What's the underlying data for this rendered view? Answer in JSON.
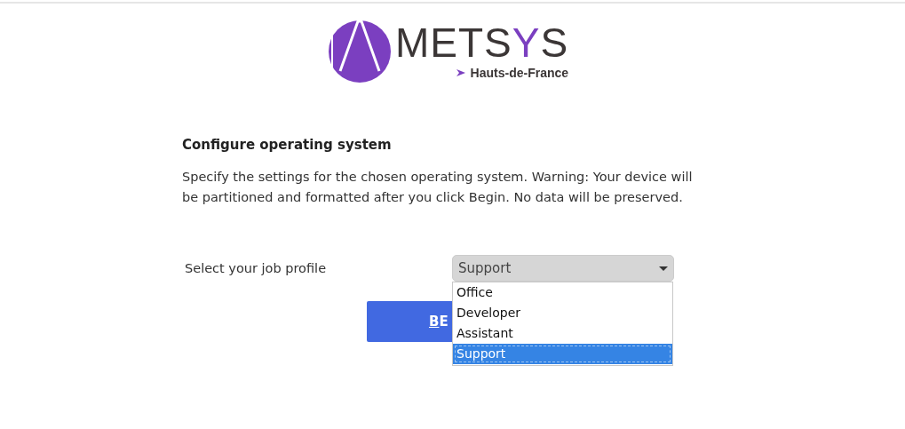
{
  "logo": {
    "wordmark": [
      {
        "text": "METS",
        "color": "#3b3636"
      },
      {
        "text": "Y",
        "color": "#7b3fc0"
      },
      {
        "text": "S",
        "color": "#3b3636"
      }
    ],
    "tagline": "Hauts-de-France"
  },
  "heading": "Configure operating system",
  "description": "Specify the settings for the chosen operating system. Warning: Your device will be partitioned and formatted after you click Begin. No data will be preserved.",
  "job_profile": {
    "label": "Select your job profile",
    "value": "Support",
    "expanded": true,
    "options": [
      {
        "label": "Office",
        "selected": false
      },
      {
        "label": "Developer",
        "selected": false
      },
      {
        "label": "Assistant",
        "selected": false
      },
      {
        "label": "Support",
        "selected": true
      }
    ]
  },
  "begin_button": {
    "label": "BE"
  }
}
